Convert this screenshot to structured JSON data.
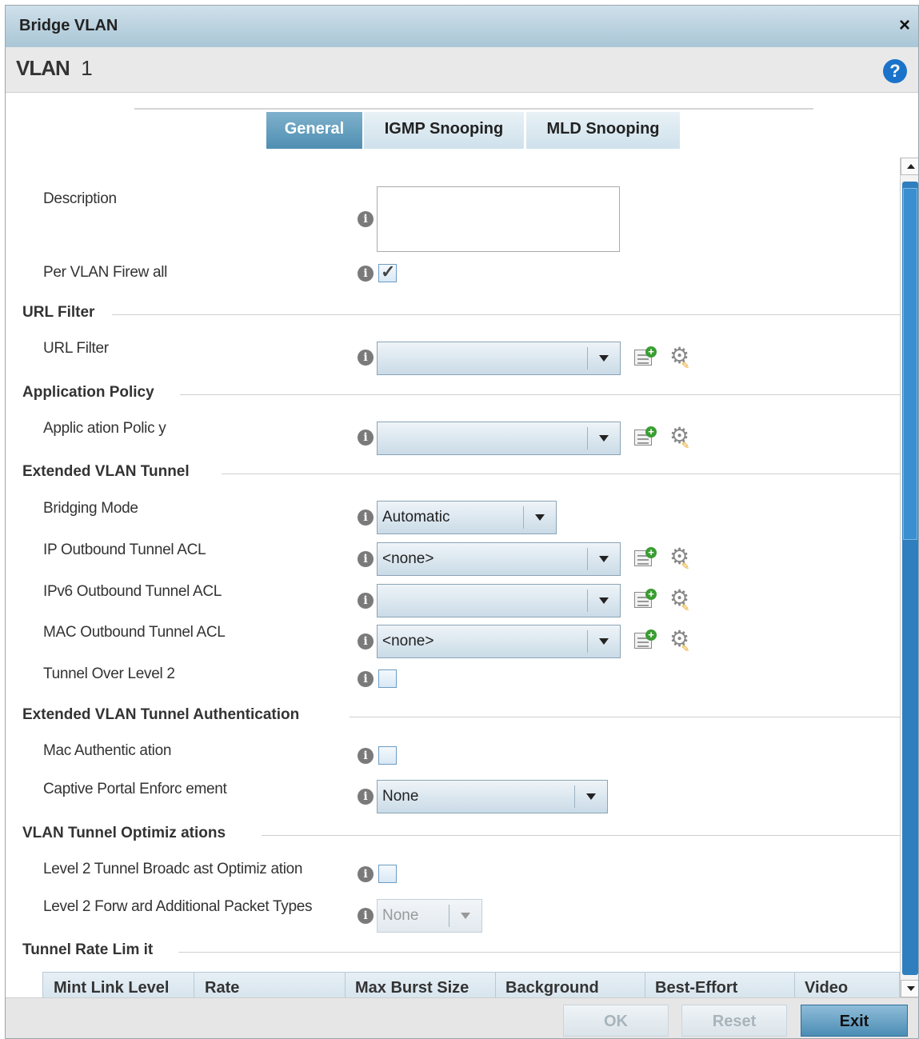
{
  "window": {
    "title": "Bridge VLAN",
    "close_glyph": "×"
  },
  "header": {
    "vlan_label": "VLAN",
    "vlan_id": "1",
    "help_glyph": "?"
  },
  "tabs": [
    {
      "label": "General",
      "active": true
    },
    {
      "label": "IGMP Snooping",
      "active": false
    },
    {
      "label": "MLD Snooping",
      "active": false
    }
  ],
  "form": {
    "description": {
      "label": "Description",
      "value": ""
    },
    "per_vlan_firewall": {
      "label": "Per VLAN Firew all",
      "checked": true
    },
    "url_filter_section": "URL Filter",
    "url_filter": {
      "label": "URL Filter",
      "value": ""
    },
    "app_policy_section": "Application Policy",
    "app_policy": {
      "label": "Applic ation Polic y",
      "value": ""
    },
    "ext_tunnel_section": "Extended VLAN Tunnel",
    "bridging_mode": {
      "label": "Bridging Mode",
      "value": "Automatic"
    },
    "ip_outbound_acl": {
      "label": "IP Outbound Tunnel ACL",
      "value": "<none>"
    },
    "ipv6_outbound_acl": {
      "label": "IPv6 Outbound Tunnel ACL",
      "value": ""
    },
    "mac_outbound_acl": {
      "label": "MAC Outbound Tunnel ACL",
      "value": "<none>"
    },
    "tunnel_over_level2": {
      "label": "Tunnel Over Level 2",
      "checked": false
    },
    "ext_tunnel_auth_section": "Extended VLAN Tunnel Authentication",
    "mac_auth": {
      "label": "Mac Authentic ation",
      "checked": false
    },
    "captive_portal": {
      "label": "Captive Portal Enforc ement",
      "value": "None"
    },
    "tunnel_opt_section": "VLAN Tunnel Optimiz ations",
    "l2_broadcast_opt": {
      "label": "Level 2 Tunnel Broadc ast Optimiz ation",
      "checked": false
    },
    "l2_forward_types": {
      "label": "Level 2 Forw ard Additional Packet Types",
      "value": "None",
      "disabled": true
    },
    "rate_limit_section": "Tunnel Rate Lim it",
    "rate_table_headers": [
      "Mint Link Level",
      "Rate",
      "Max Burst Size",
      "Background",
      "Best-Effort",
      "Video"
    ]
  },
  "icons": {
    "info": "info-icon",
    "add": "add-policy-icon",
    "edit": "gear-icon"
  },
  "footer": {
    "ok": "OK",
    "reset": "Reset",
    "exit": "Exit"
  },
  "colors": {
    "accent": "#4f8fb2",
    "help": "#1a73c9",
    "scrollbar": "#2f7fbf"
  }
}
